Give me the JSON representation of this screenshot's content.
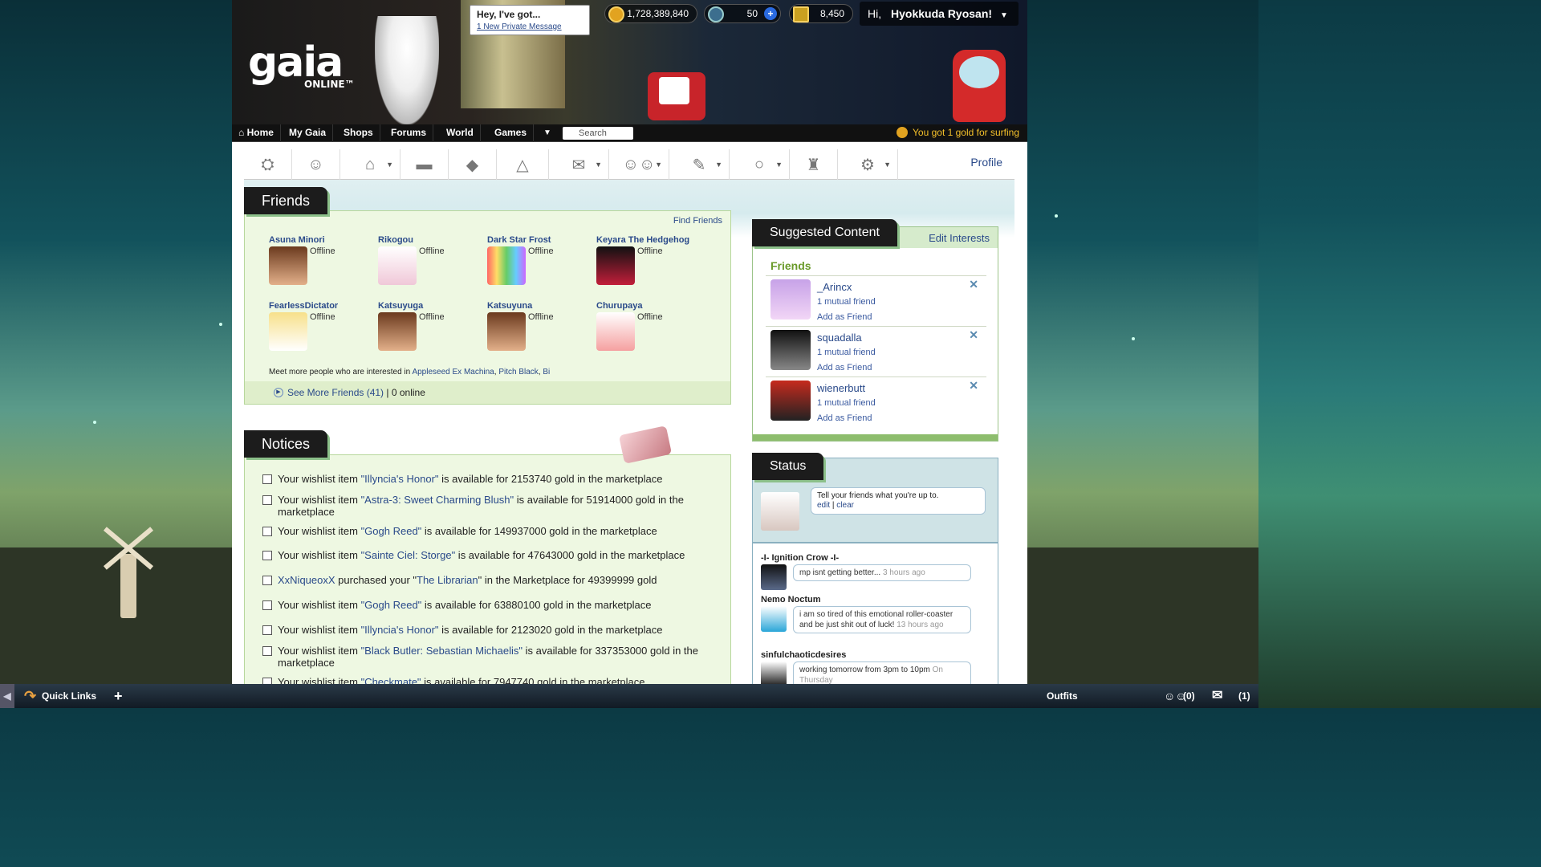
{
  "header": {
    "logo_text": "gaia",
    "logo_sub": "ONLINE™",
    "message_bubble": {
      "title": "Hey, I've got...",
      "link": "1 New Private Message"
    },
    "gold": "1,728,389,840",
    "gaia_cash": "50",
    "trophies": "8,450",
    "greeting_prefix": "Hi,",
    "username": "Hyokkuda Ryosan!"
  },
  "nav": {
    "items": [
      "Home",
      "My Gaia",
      "Shops",
      "Forums",
      "World",
      "Games"
    ],
    "search_placeholder": "Search",
    "surf_message": "You got 1 gold for surfing"
  },
  "toolbar": {
    "profile_label": "Profile"
  },
  "friends": {
    "title": "Friends",
    "find_label": "Find Friends",
    "list": [
      {
        "name": "Asuna Minori",
        "status": "Offline"
      },
      {
        "name": "Rikogou",
        "status": "Offline"
      },
      {
        "name": "Dark Star Frost",
        "status": "Offline"
      },
      {
        "name": "Keyara The Hedgehog",
        "status": "Offline"
      },
      {
        "name": "FearlessDictator",
        "status": "Offline"
      },
      {
        "name": "Katsuyuga",
        "status": "Offline"
      },
      {
        "name": "Katsuyuna",
        "status": "Offline"
      },
      {
        "name": "Churupaya",
        "status": "Offline"
      }
    ],
    "meet_prefix": "Meet more people who are interested in",
    "interests": [
      "Appleseed Ex Machina",
      "Pitch Black",
      "Bi"
    ],
    "see_more": "See More Friends (41)",
    "online_count": "| 0 online"
  },
  "notices": {
    "title": "Notices",
    "items": [
      {
        "pre": "Your wishlist item ",
        "link": "\"Illyncia's Honor\"",
        "post": " is available for 2153740 gold in the marketplace"
      },
      {
        "pre": "Your wishlist item ",
        "link": "\"Astra-3: Sweet Charming Blush\"",
        "post": " is available for 51914000 gold in the marketplace"
      },
      {
        "pre": "Your wishlist item ",
        "link": "\"Gogh Reed\"",
        "post": " is available for 149937000 gold in the marketplace"
      },
      {
        "pre": "Your wishlist item ",
        "link": "\"Sainte Ciel: Storge\"",
        "post": " is available for 47643000 gold in the marketplace"
      },
      {
        "pre": "",
        "link": "XxNiqueoxX",
        "post": " purchased your \"The Librarian\" in the Marketplace for 49399999 gold"
      },
      {
        "pre": "Your wishlist item ",
        "link": "\"Gogh Reed\"",
        "post": " is available for 63880100 gold in the marketplace"
      },
      {
        "pre": "Your wishlist item ",
        "link": "\"Illyncia's Honor\"",
        "post": " is available for 2123020 gold in the marketplace"
      },
      {
        "pre": "Your wishlist item ",
        "link": "\"Black Butler: Sebastian Michaelis\"",
        "post": " is available for 337353000 gold in the marketplace"
      },
      {
        "pre": "Your wishlist item ",
        "link": "\"Checkmate\"",
        "post": " is available for 7947740 gold in the marketplace"
      }
    ],
    "librarian_link": "\"The Librarian\""
  },
  "suggested": {
    "title": "Suggested Content",
    "edit_label": "Edit Interests",
    "section_label": "Friends",
    "list": [
      {
        "name": "_Arincx",
        "mutual": "1 mutual friend",
        "add": "Add as Friend"
      },
      {
        "name": "squadalla",
        "mutual": "1 mutual friend",
        "add": "Add as Friend"
      },
      {
        "name": "wienerbutt",
        "mutual": "1 mutual friend",
        "add": "Add as Friend"
      }
    ]
  },
  "status": {
    "title": "Status",
    "prompt": "Tell your friends what you're up to.",
    "edit": "edit",
    "sep": "|",
    "clear": "clear",
    "feed": [
      {
        "name": "-I- Ignition Crow -I-",
        "msg": "mp isnt getting better...",
        "time": "3 hours ago"
      },
      {
        "name": "Nemo Noctum",
        "msg": "i am so tired of this emotional roller-coaster and be just shit out of luck!",
        "time": "13 hours ago"
      },
      {
        "name": "sinfulchaoticdesires",
        "msg": "working tomorrow from 3pm to 10pm",
        "time": "On Thursday"
      }
    ]
  },
  "bottombar": {
    "quick_links": "Quick Links",
    "plus": "+",
    "outfits": "Outfits",
    "friends_count": "(0)",
    "messages_count": "(1)"
  }
}
